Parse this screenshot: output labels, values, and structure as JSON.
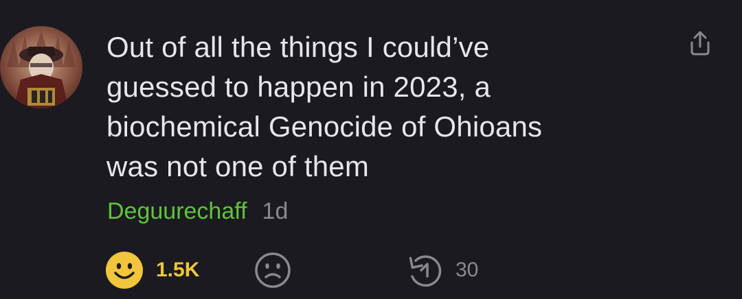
{
  "comment": {
    "text_lines": [
      "Out of all the things I could’ve",
      "guessed to happen in 2023, a",
      "biochemical Genocide of Ohioans",
      "was not one of them"
    ],
    "author": "Deguurechaff",
    "age": "1d"
  },
  "actions": {
    "like_count": "1.5K",
    "reply_count": "30"
  },
  "colors": {
    "background": "#1b1a20",
    "author": "#5fc43a",
    "like_accent": "#f2c53d",
    "muted": "#8a8990"
  },
  "icons": {
    "share": "share-icon",
    "like": "smile-face-icon",
    "dislike": "frown-face-icon",
    "reply": "reply-icon"
  }
}
